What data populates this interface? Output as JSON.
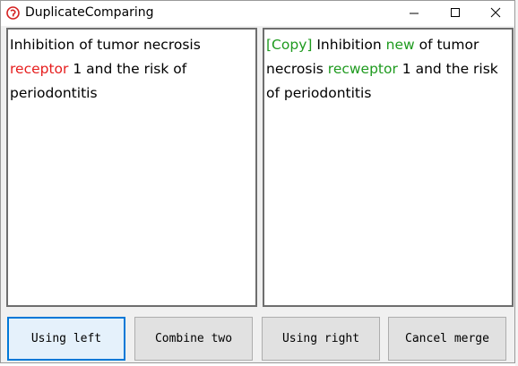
{
  "window": {
    "title": "DuplicateComparing"
  },
  "colors": {
    "diff_removed": "#e61e1e",
    "diff_added": "#1e9a1e",
    "default_button_border": "#0078d7"
  },
  "left_text": {
    "seg1": "Inhibition of tumor necrosis ",
    "seg2": "receptor",
    "seg3": " 1 and the risk of periodontitis"
  },
  "right_text": {
    "seg1": "[Copy]",
    "seg2": " Inhibition ",
    "seg3": "new",
    "seg4": " of tumor necrosis ",
    "seg5": "recweptor",
    "seg6": " 1 and the risk of periodontitis"
  },
  "buttons": {
    "using_left": "Using left",
    "combine_two": "Combine two",
    "using_right": "Using right",
    "cancel_merge": "Cancel merge"
  }
}
